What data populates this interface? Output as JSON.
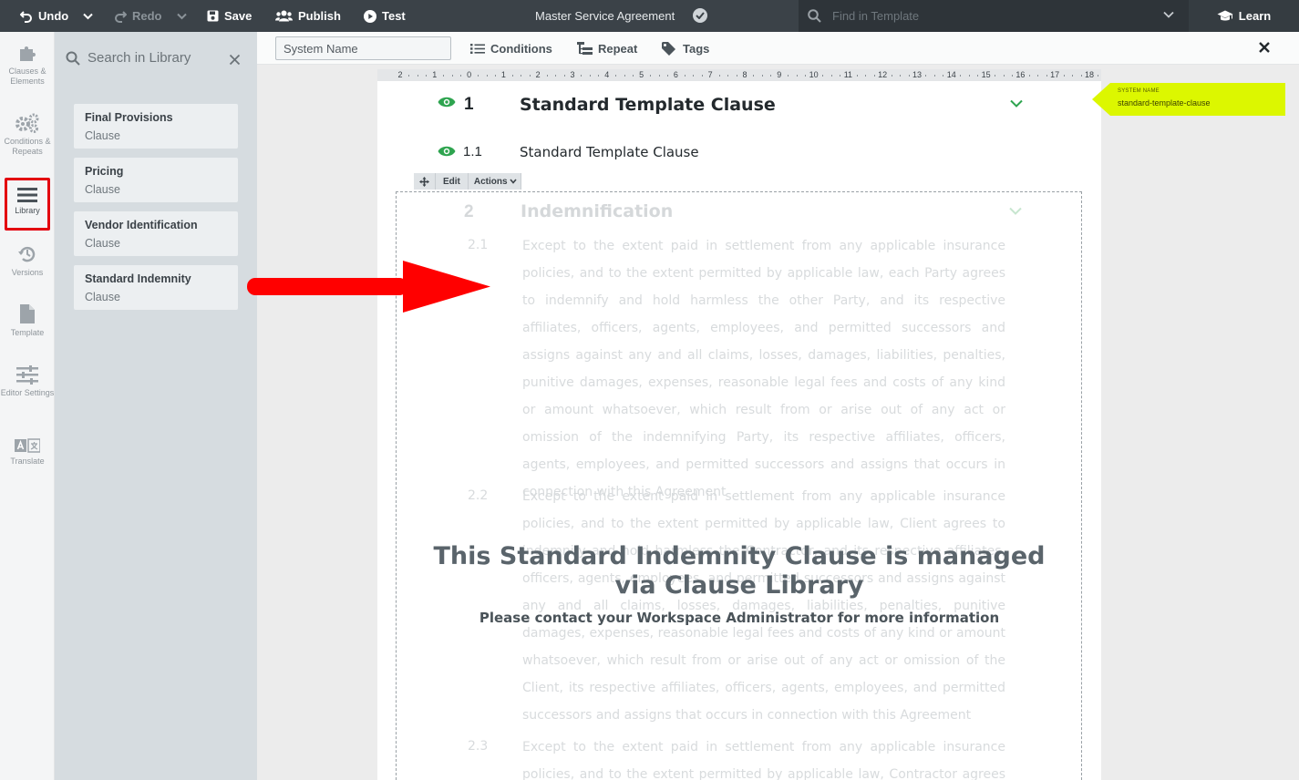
{
  "topbar": {
    "undo": "Undo",
    "redo": "Redo",
    "save": "Save",
    "publish": "Publish",
    "test": "Test",
    "title": "Master Service Agreement",
    "find_placeholder": "Find in Template",
    "learn": "Learn"
  },
  "rail": {
    "clauses": "Clauses & Elements",
    "conditions": "Conditions & Repeats",
    "library": "Library",
    "versions": "Versions",
    "template": "Template",
    "editor_settings": "Editor Settings",
    "translate": "Translate"
  },
  "library": {
    "search_placeholder": "Search in Library",
    "items": [
      {
        "title": "Final Provisions",
        "type": "Clause"
      },
      {
        "title": "Pricing",
        "type": "Clause"
      },
      {
        "title": "Vendor Identification",
        "type": "Clause"
      },
      {
        "title": "Standard Indemnity",
        "type": "Clause"
      }
    ]
  },
  "toolbar2": {
    "system_name_placeholder": "System Name",
    "conditions": "Conditions",
    "repeat": "Repeat",
    "tags": "Tags"
  },
  "ruler": {
    "labels": [
      "2",
      "1",
      "0",
      "1",
      "2",
      "3",
      "4",
      "5",
      "6",
      "7",
      "8",
      "9",
      "10",
      "11",
      "12",
      "13",
      "14",
      "15",
      "16",
      "17",
      "18"
    ]
  },
  "document": {
    "clause1": {
      "number": "1",
      "title": "Standard Template Clause"
    },
    "clause11": {
      "number": "1.1",
      "title": "Standard Template Clause"
    },
    "mini_toolbar": {
      "edit": "Edit",
      "actions": "Actions"
    },
    "clause2": {
      "number": "2",
      "title": "Indemnification"
    },
    "sub": [
      {
        "number": "2.1",
        "text": "Except to the extent paid in settlement from any applicable insurance policies, and to the extent permitted by applicable law, each Party agrees to indemnify and hold harmless the other Party, and its respective affiliates, officers, agents, employees, and permitted successors and assigns against any and all claims, losses, damages, liabilities, penalties, punitive damages, expenses, reasonable legal fees and costs of any kind or amount whatsoever, which result from or arise out of any act or omission of the indemnifying Party, its respective affiliates, officers, agents, employees, and permitted successors and assigns that occurs in connection with this Agreement"
      },
      {
        "number": "2.2",
        "text": "Except to the extent paid in settlement from any applicable insurance policies, and to the extent permitted by applicable law, Client agrees to indemnify and hold harmless the Contractor, and its respective affiliates, officers, agents, employees, and permitted successors and assigns against any and all claims, losses, damages, liabilities, penalties, punitive damages, expenses, reasonable legal fees and costs of any kind or amount whatsoever, which result from or arise out of any act or omission of the Client, its respective affiliates, officers, agents, employees, and permitted successors and assigns that occurs in connection with this Agreement"
      },
      {
        "number": "2.3",
        "text": "Except to the extent paid in settlement from any applicable insurance policies, and to the extent permitted by applicable law, Contractor agrees to"
      }
    ],
    "overlay_title": "This Standard Indemnity Clause is managed via Clause Library",
    "overlay_sub": "Please contact your Workspace Administrator for more information"
  },
  "system_name_tag": {
    "label": "SYSTEM NAME",
    "value": "standard-template-clause"
  },
  "colors": {
    "accent_green": "#2ea44f",
    "tag_yellow": "#dcf700",
    "highlight_red": "#e3000f"
  }
}
